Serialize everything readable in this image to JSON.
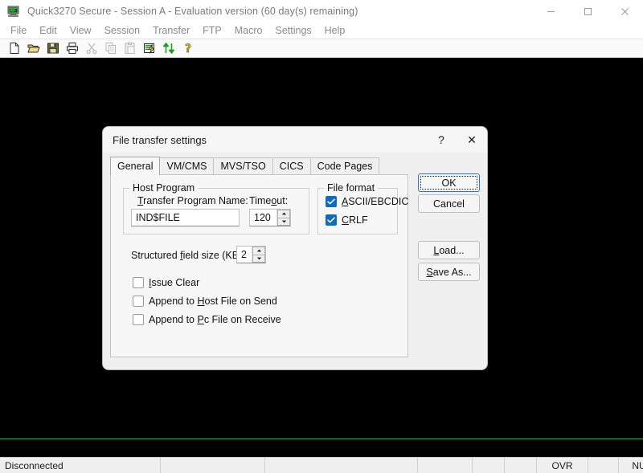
{
  "window": {
    "title": "Quick3270 Secure - Session A - Evaluation version (60 day(s) remaining)",
    "icon": "terminal-monitor-icon",
    "controls": {
      "minimize": "minimize-icon",
      "maximize": "maximize-icon",
      "close": "close-icon"
    }
  },
  "menubar": {
    "items": [
      {
        "label": "File"
      },
      {
        "label": "Edit"
      },
      {
        "label": "View"
      },
      {
        "label": "Session"
      },
      {
        "label": "Transfer"
      },
      {
        "label": "FTP"
      },
      {
        "label": "Macro"
      },
      {
        "label": "Settings"
      },
      {
        "label": "Help"
      }
    ]
  },
  "toolbar": {
    "buttons": [
      {
        "name": "new-file-icon",
        "enabled": true
      },
      {
        "name": "open-folder-icon",
        "enabled": true
      },
      {
        "name": "save-disk-icon",
        "enabled": true
      },
      {
        "name": "print-icon",
        "enabled": true
      },
      {
        "name": "cut-scissors-icon",
        "enabled": false
      },
      {
        "name": "copy-icon",
        "enabled": false
      },
      {
        "name": "paste-clipboard-icon",
        "enabled": false
      },
      {
        "name": "keyboard-macro-icon",
        "enabled": true
      },
      {
        "name": "file-transfer-arrows-icon",
        "enabled": true
      },
      {
        "name": "help-question-icon",
        "enabled": true
      }
    ]
  },
  "terminal": {
    "background_color": "#000000",
    "rule_color": "#00c000"
  },
  "statusbar": {
    "connection": "Disconnected",
    "cells": [
      "",
      "",
      "",
      "",
      ""
    ],
    "overwrite_mode": "OVR",
    "num_lock": "NUM"
  },
  "dialog": {
    "title": "File transfer settings",
    "help_glyph": "?",
    "close_glyph": "✕",
    "tabs": [
      {
        "label": "General",
        "active": true
      },
      {
        "label": "VM/CMS",
        "active": false
      },
      {
        "label": "MVS/TSO",
        "active": false
      },
      {
        "label": "CICS",
        "active": false
      },
      {
        "label": "Code Pages",
        "active": false
      }
    ],
    "host_program": {
      "group_label": "Host Program",
      "transfer_program_label_pre": "",
      "transfer_program_label_key": "T",
      "transfer_program_label_post": "ransfer Program Name:",
      "transfer_program_value": "IND$FILE",
      "timeout_label_pre": "Time",
      "timeout_label_key": "o",
      "timeout_label_post": "ut:",
      "timeout_value": "120"
    },
    "file_format": {
      "group_label": "File format",
      "options": [
        {
          "label_pre": "",
          "label_key": "A",
          "label_post": "SCII/EBCDIC",
          "checked": true
        },
        {
          "label_pre": "",
          "label_key": "C",
          "label_post": "RLF",
          "checked": true
        }
      ]
    },
    "structured_field": {
      "label_pre": "Structured ",
      "label_key": "f",
      "label_post": "ield size (KB):",
      "value": "2"
    },
    "options": [
      {
        "label_pre": "",
        "label_key": "I",
        "label_post": "ssue Clear",
        "checked": false
      },
      {
        "label_pre": "Append  to ",
        "label_key": "H",
        "label_post": "ost File on Send",
        "checked": false
      },
      {
        "label_pre": "Append  to ",
        "label_key": "P",
        "label_post": "c File on Receive",
        "checked": false
      }
    ],
    "buttons": {
      "ok": {
        "label": "OK",
        "default": true
      },
      "cancel": {
        "label": "Cancel"
      },
      "load": {
        "label_pre": "",
        "label_key": "L",
        "label_post": "oad..."
      },
      "save_as": {
        "label_pre": "",
        "label_key": "S",
        "label_post": "ave As..."
      }
    }
  },
  "colors": {
    "accent": "#0f6cbd",
    "default_button_border": "#2a74c0",
    "terminal_green": "#00c000",
    "dialog_face": "#f0f0f0",
    "panel_face": "#f7f7f7"
  }
}
